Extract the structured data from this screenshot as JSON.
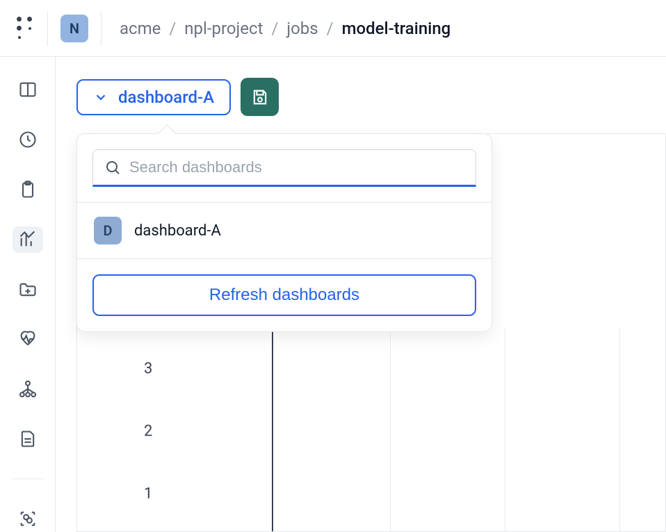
{
  "workspace_initial": "N",
  "breadcrumb": {
    "items": [
      "acme",
      "npl-project",
      "jobs",
      "model-training"
    ]
  },
  "dashboard": {
    "selected": "dashboard-A"
  },
  "dropdown": {
    "search_placeholder": "Search dashboards",
    "items": [
      {
        "initial": "D",
        "name": "dashboard-A"
      }
    ],
    "refresh_label": "Refresh dashboards"
  },
  "chart_data": {
    "type": "line",
    "y_ticks": [
      3,
      2,
      1
    ],
    "ylim": [
      0,
      4
    ]
  },
  "colors": {
    "accent": "#2563eb",
    "save_bg": "#2a6f63",
    "badge_bg": "#93b4e0"
  }
}
